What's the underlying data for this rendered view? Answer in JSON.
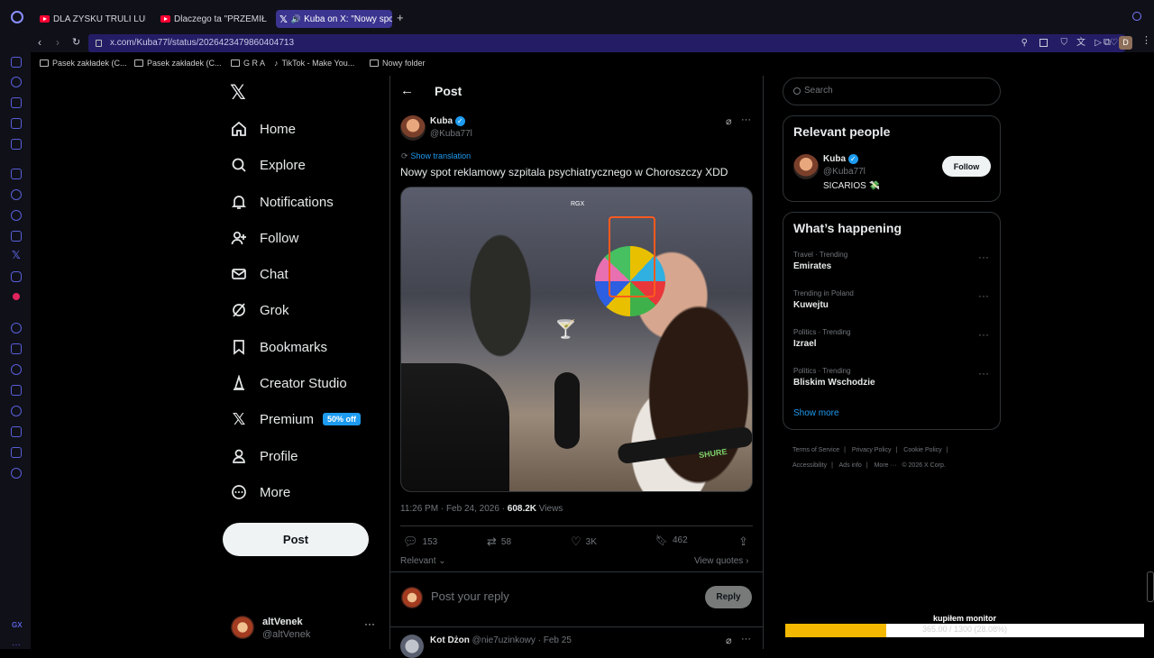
{
  "browser": {
    "tabs": [
      {
        "label": "DLA ZYSKU TRULI LUDZI",
        "type": "youtube"
      },
      {
        "label": "Dlaczego ta \"PRZEMIŁA\"",
        "type": "youtube"
      },
      {
        "label": "Kuba on X: \"Nowy spo",
        "type": "x",
        "active": true
      }
    ],
    "url": "x.com/Kuba77l/status/2026423479860404713",
    "profile_initial": "D",
    "bookmarks": [
      "Pasek zakładek (C...",
      "Pasek zakładek (C...",
      "G R A",
      "TikTok - Make You...",
      "Nowy folder"
    ]
  },
  "nav": {
    "items": [
      {
        "label": "Home",
        "icon": "home-icon"
      },
      {
        "label": "Explore",
        "icon": "search-icon"
      },
      {
        "label": "Notifications",
        "icon": "bell-icon"
      },
      {
        "label": "Follow",
        "icon": "follow-icon"
      },
      {
        "label": "Chat",
        "icon": "mail-icon"
      },
      {
        "label": "Grok",
        "icon": "grok-icon"
      },
      {
        "label": "Bookmarks",
        "icon": "bookmark-icon"
      },
      {
        "label": "Creator Studio",
        "icon": "creator-icon"
      },
      {
        "label": "Premium",
        "icon": "x-icon"
      },
      {
        "label": "Profile",
        "icon": "person-icon"
      },
      {
        "label": "More",
        "icon": "more-circle-icon"
      }
    ],
    "premium_badge": "50% off",
    "post_button": "Post",
    "account": {
      "name": "altVenek",
      "handle": "@altVenek"
    }
  },
  "post": {
    "header_title": "Post",
    "author_name": "Kuba",
    "author_handle": "@Kuba77l",
    "show_translation": "Show translation",
    "text": "Nowy spot reklamowy szpitala psychiatrycznego w Choroszczy XDD",
    "video_overlay": "RGX",
    "timestamp": "11:26 PM · Feb 24, 2026 · ",
    "views_count": "608.2K",
    "views_label": " Views",
    "replies": "153",
    "reposts": "58",
    "likes": "3K",
    "bookmarks": "462",
    "relevant_label": "Relevant",
    "view_quotes": "View quotes",
    "reply_placeholder": "Post your reply",
    "reply_button": "Reply",
    "next_reply": {
      "name": "Kot Dżon",
      "handle": "@nie7uzinkowy",
      "date": "· Feb 25"
    }
  },
  "sidebar": {
    "search_placeholder": "Search",
    "relevant_title": "Relevant people",
    "person": {
      "name": "Kuba",
      "handle": "@Kuba77l",
      "bio": "SICARIOS 💸",
      "follow": "Follow"
    },
    "happening_title": "What’s happening",
    "trends": [
      {
        "context": "Travel · Trending",
        "topic": "Emirates"
      },
      {
        "context": "Trending in Poland",
        "topic": "Kuwejtu"
      },
      {
        "context": "Politics · Trending",
        "topic": "Izrael"
      },
      {
        "context": "Politics · Trending",
        "topic": "Bliskim Wschodzie"
      }
    ],
    "show_more": "Show more",
    "footer": [
      "Terms of Service",
      "Privacy Policy",
      "Cookie Policy",
      "Accessibility",
      "Ads info",
      "More ···",
      "© 2026 X Corp."
    ]
  },
  "overlay": {
    "title": "kupiłem monitor",
    "progress_text": "365.00 / 1300 (28.08%)",
    "progress_fraction": 0.2808,
    "fill_color": "#f5b800"
  },
  "colors": {
    "accent": "#1d9bf0",
    "opera_accent": "#3b3490"
  }
}
